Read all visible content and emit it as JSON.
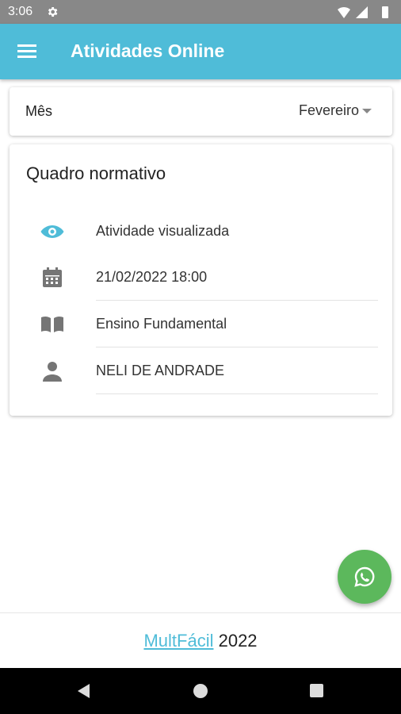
{
  "status_bar": {
    "time": "3:06"
  },
  "app_bar": {
    "title": "Atividades Online",
    "menu_icon": "menu-icon"
  },
  "month_filter": {
    "label": "Mês",
    "selected": "Fevereiro"
  },
  "card": {
    "title": "Quadro normativo",
    "rows": [
      {
        "icon": "eye-icon",
        "text": "Atividade visualizada",
        "icon_color": "#4fbcd8"
      },
      {
        "icon": "calendar-icon",
        "text": "21/02/2022 18:00",
        "icon_color": "#757575"
      },
      {
        "icon": "book-icon",
        "text": "Ensino Fundamental",
        "icon_color": "#757575"
      },
      {
        "icon": "person-icon",
        "text": "NELI DE ANDRADE",
        "icon_color": "#757575"
      }
    ]
  },
  "fab": {
    "icon": "whatsapp-icon",
    "color": "#5cb85c"
  },
  "footer": {
    "link_text": "MultFácil",
    "year": "2022"
  },
  "colors": {
    "primary": "#4fbcd8",
    "status_bar": "#888888"
  }
}
